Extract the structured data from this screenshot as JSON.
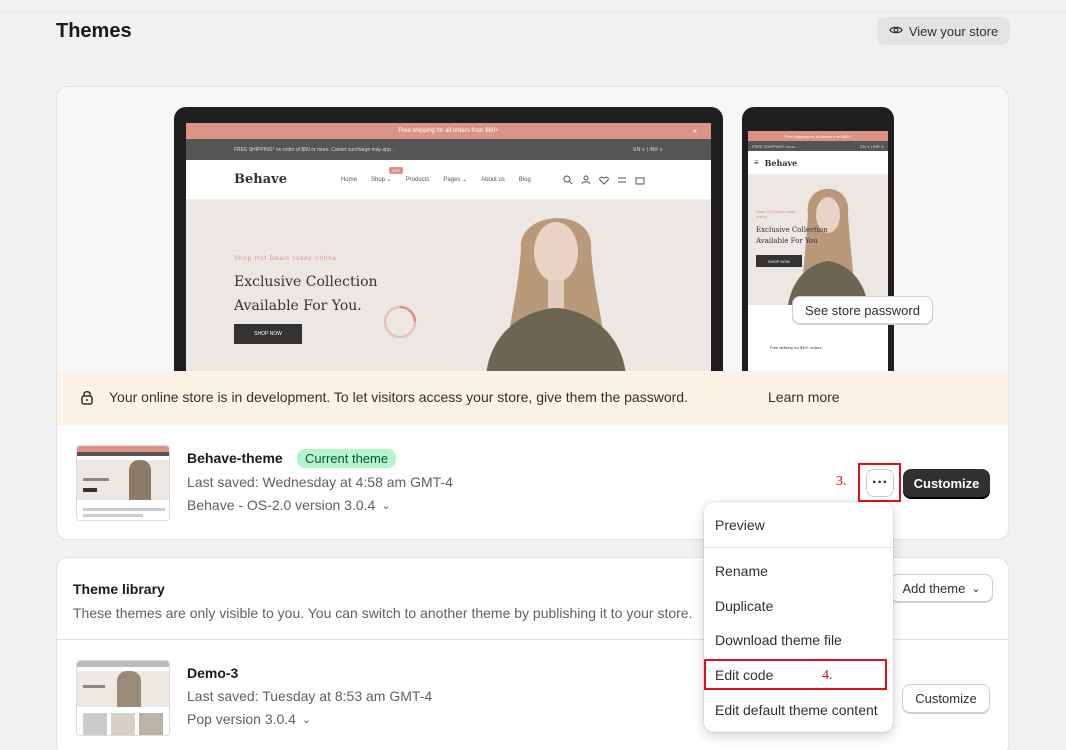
{
  "header": {
    "title": "Themes",
    "view_store_label": "View your store"
  },
  "store_preview": {
    "promo_bar": "Free shipping for all orders from $60+",
    "ship_bar": "FREE SHIPPING* on order of $50 or more. Carrier surcharge may app...",
    "lang_currency": "EN ∨  |  INR ∨",
    "logo": "Behave",
    "nav": [
      "Home",
      "Shop",
      "Products",
      "Pages",
      "About us",
      "Blog"
    ],
    "nav_badge": "HOT",
    "hero_kicker": "Shop Hot Deals today online",
    "hero_title": "Exclusive Collection Available For You.",
    "hero_button": "SHOP NOW",
    "mobile_promo": "Free shipping for all orders from $60+",
    "mobile_ship": "FREE SHIPPING* on or...",
    "mobile_lang": "EN ∨ | INR ∨",
    "mobile_kicker": "Shop Hot Deals today online",
    "mobile_title": "Exclusive Collection Available For You",
    "mobile_button": "SHOP NOW",
    "mobile_delivery": "Free delivery for $40+ orders"
  },
  "banner": {
    "text": "Your online store is in development. To let visitors access your store, give them the password.",
    "learn_more": "Learn more",
    "see_password": "See store password"
  },
  "current_theme": {
    "name": "Behave-theme",
    "badge": "Current theme",
    "last_saved": "Last saved: Wednesday at 4:58 am GMT-4",
    "version": "Behave - OS-2.0 version 3.0.4",
    "actions_label": "···",
    "customize": "Customize",
    "step_label": "3."
  },
  "library": {
    "title": "Theme library",
    "description": "These themes are only visible to you. You can switch to another theme by publishing it to your store.",
    "add_theme": "Add theme",
    "themes": [
      {
        "name": "Demo-3",
        "last_saved": "Last saved: Tuesday at 8:53 am GMT-4",
        "version": "Pop version 3.0.4",
        "customize": "Customize"
      }
    ]
  },
  "menu": {
    "items": [
      "Preview",
      "Rename",
      "Duplicate",
      "Download theme file",
      "Edit code",
      "Edit default theme content"
    ],
    "step_label": "4."
  },
  "colors": {
    "accent_dark": "#303030",
    "promo": "#d99485",
    "annotation_red": "#e0101a",
    "badge_green": "#b5f5cd"
  }
}
